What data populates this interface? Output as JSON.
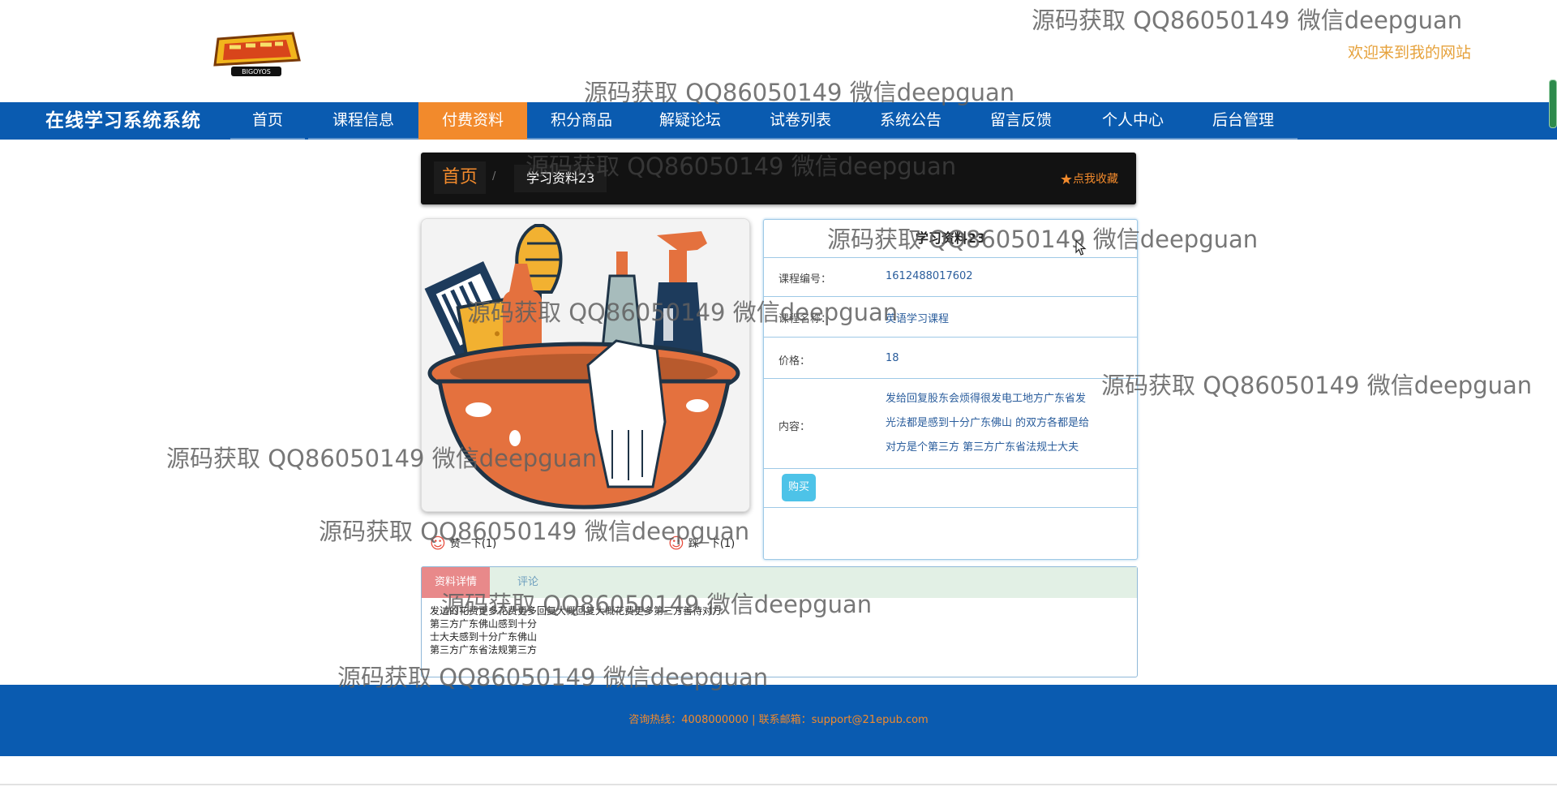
{
  "header": {
    "welcome": "欢迎来到我的网站",
    "logo_alt": "BIGOYOS"
  },
  "nav": {
    "site_title": "在线学习系统系统",
    "items": [
      {
        "label": "首页"
      },
      {
        "label": "课程信息"
      },
      {
        "label": "付费资料",
        "active": true
      },
      {
        "label": "积分商品"
      },
      {
        "label": "解疑论坛"
      },
      {
        "label": "试卷列表"
      },
      {
        "label": "系统公告"
      },
      {
        "label": "留言反馈"
      },
      {
        "label": "个人中心"
      },
      {
        "label": "后台管理"
      }
    ]
  },
  "breadcrumb": {
    "home": "首页",
    "separator": "/",
    "current": "学习资料23",
    "favorite": "点我收藏"
  },
  "product": {
    "title": "学习资料23",
    "fields": [
      {
        "label": "课程编号：",
        "value": "1612488017602"
      },
      {
        "label": "课程名称：",
        "value": "英语学习课程"
      },
      {
        "label": "价格：",
        "value": "18"
      }
    ],
    "content_label": "内容：",
    "content_lines": [
      "发给回复股东会烦得很发电工地方广东省发",
      "光法都是感到十分广东佛山 的双方各都是给",
      "对方是个第三方 第三方广东省法规士大夫"
    ],
    "buy_label": "购买",
    "like_label": "赞一下(1)",
    "dislike_label": "踩一下(1)"
  },
  "details": {
    "tab_active": "资料详情",
    "tab_other": "评论",
    "lines": [
      "发过的花费更多花费更多回复大概回复大概花费更多第三方善待对方",
      "第三方广东佛山感到十分",
      "士大夫感到十分广东佛山",
      "第三方广东省法规第三方"
    ]
  },
  "footer": {
    "text": "咨询热线：4008000000 | 联系邮箱：support@21epub.com"
  },
  "watermark": {
    "text": "源码获取 QQ86050149 微信deepguan"
  },
  "colors": {
    "nav_bg": "#0a5bb0",
    "accent": "#f28a2c",
    "card_border": "#9ec9e6",
    "buy_button": "#4dc3e8",
    "tab_active": "#e8898a",
    "tab_bar": "#e2f0e5"
  },
  "icons": {
    "favorite": "star-icon",
    "like": "smiley-icon",
    "dislike": "smiley-icon",
    "cursor": "mouse-cursor-icon"
  }
}
